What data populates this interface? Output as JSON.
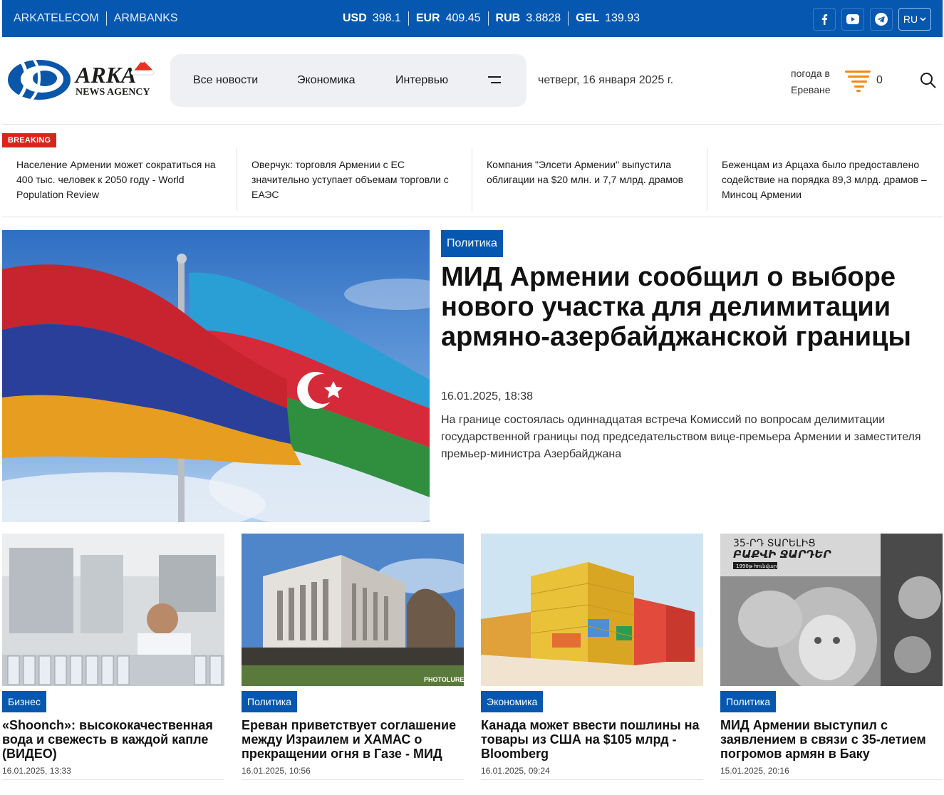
{
  "topbar": {
    "links": [
      "ARKATELECOM",
      "ARMBANKS"
    ],
    "rates": [
      {
        "code": "USD",
        "value": "398.1"
      },
      {
        "code": "EUR",
        "value": "409.45"
      },
      {
        "code": "RUB",
        "value": "3.8828"
      },
      {
        "code": "GEL",
        "value": "139.93"
      }
    ],
    "social": [
      "facebook-icon",
      "youtube-icon",
      "telegram-icon"
    ],
    "language": "RU"
  },
  "header": {
    "logo_text": "ARKA",
    "logo_sub": "NEWS AGENCY",
    "nav": [
      "Все новости",
      "Экономика",
      "Интервью"
    ],
    "date": "четверг, 16 января 2025 г.",
    "weather_label": "погода в Ереване",
    "weather_value": "0"
  },
  "breaking": {
    "label": "BREAKING",
    "items": [
      "Население Армении может сократиться на 400 тыс. человек к 2050 году - World Population Review",
      "Оверчук: торговля Армении с ЕС значительно уступает объемам торговли с ЕАЭС",
      "Компания \"Элсети Армении\" выпустила облигации на $20 млн. и 7,7 млрд. драмов",
      "Беженцам из Арцаха было предоставлено содействие на порядка 89,3 млрд. драмов – Минсоц Армении"
    ]
  },
  "hero": {
    "category": "Политика",
    "title": "МИД Армении сообщил о выборе нового участка для делимитации армяно-азербайджанской границы",
    "time": "16.01.2025, 18:38",
    "lead": "На границе состоялась одиннадцатая встреча Комиссий по вопросам делимитации государственной границы под председательством вице-премьера Армении и заместителя премьер-министра Азербайджана"
  },
  "cards": [
    {
      "category": "Бизнес",
      "title": "«Shoonch»: высококачественная вода и свежесть в каждой капле (ВИДЕО)",
      "time": "16.01.2025, 13:33"
    },
    {
      "category": "Политика",
      "title": "Ереван приветствует соглашение между Израилем и ХАМАС о прекращении огня в Газе - МИД",
      "time": "16.01.2025, 10:56",
      "watermark": "PHOTOLURE"
    },
    {
      "category": "Экономика",
      "title": "Канада может ввести пошлины на товары из США на $105 млрд - Bloomberg",
      "time": "16.01.2025, 09:24"
    },
    {
      "category": "Политика",
      "title": "МИД Армении выступил с заявлением в связи с 35-летием погромов армян в Баку",
      "time": "15.01.2025, 20:16",
      "overlay_title": "35-ՐԴ ՏԱՐԵԼԻՑ",
      "overlay_sub": "ԲԱՔՎԻ ՋԱՐԴԵՐ",
      "overlay_year": "1990թ հունվար"
    }
  ],
  "colors": {
    "brand": "#0657b0",
    "breaking": "#d9261c",
    "weather": "#f08a12"
  }
}
